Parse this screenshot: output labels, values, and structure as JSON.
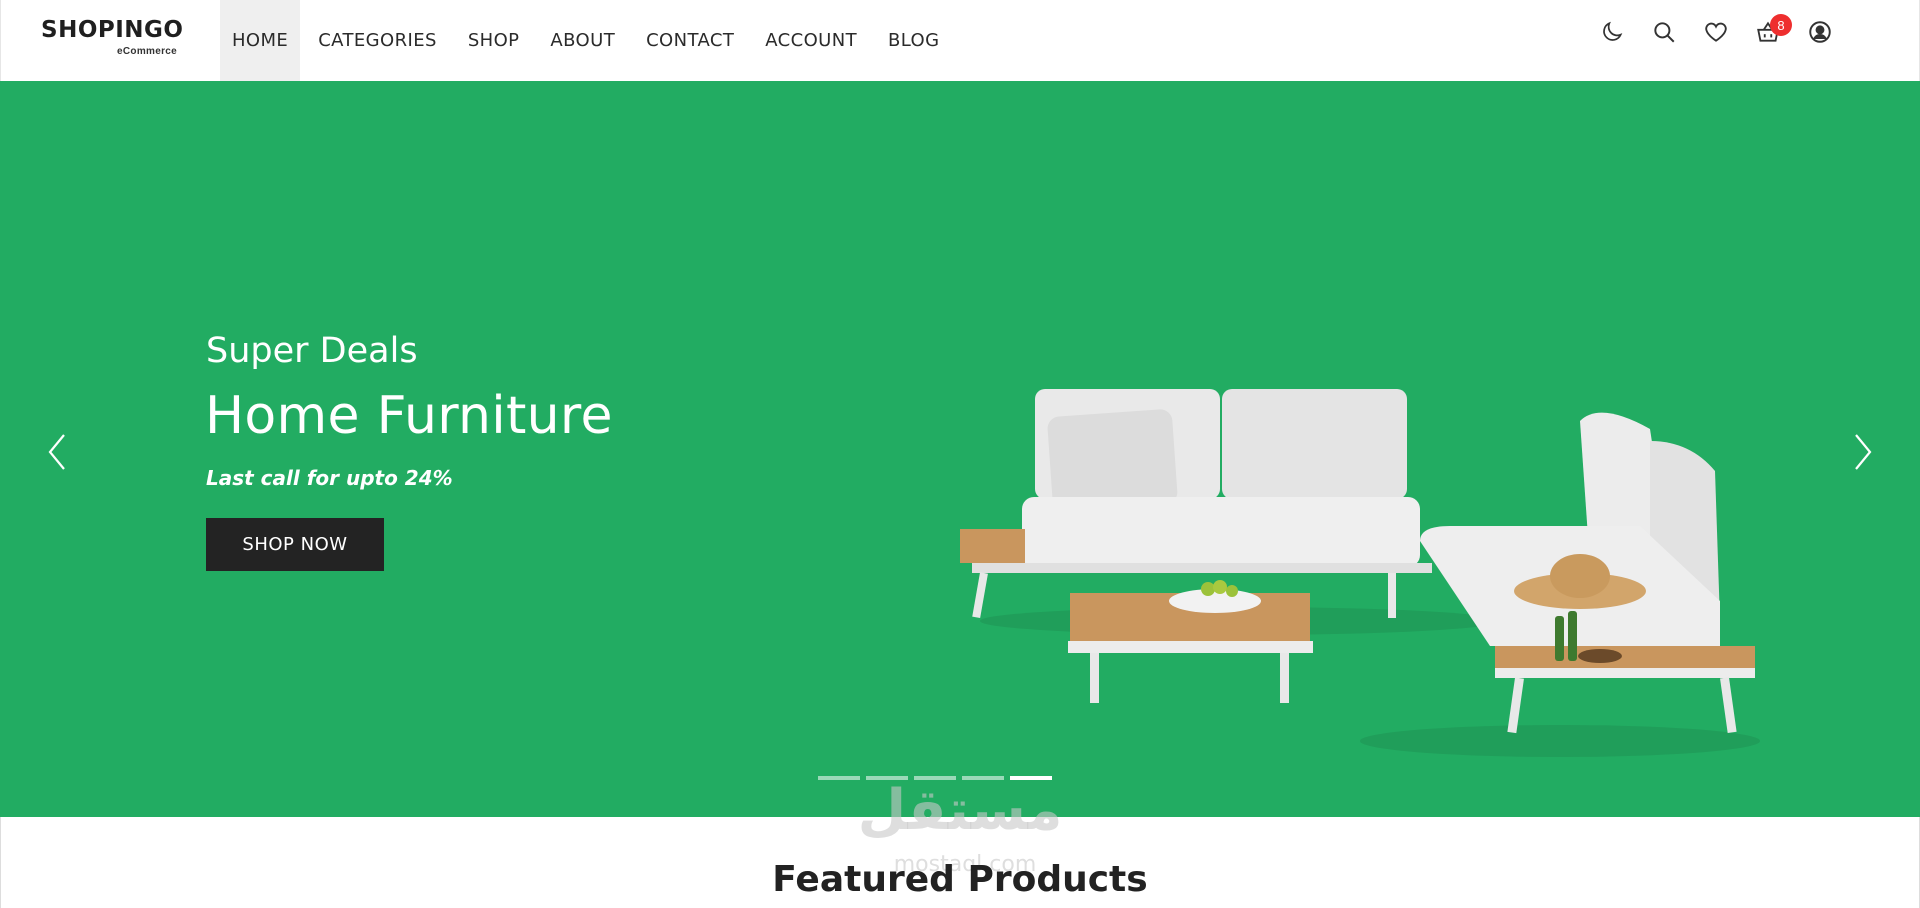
{
  "brand": {
    "name": "SHOPINGO",
    "tagline": "eCommerce"
  },
  "nav": {
    "items": [
      {
        "label": "HOME",
        "active": true
      },
      {
        "label": "CATEGORIES",
        "active": false
      },
      {
        "label": "SHOP",
        "active": false
      },
      {
        "label": "ABOUT",
        "active": false
      },
      {
        "label": "CONTACT",
        "active": false
      },
      {
        "label": "ACCOUNT",
        "active": false
      },
      {
        "label": "BLOG",
        "active": false
      }
    ]
  },
  "header_icons": {
    "theme": "moon-icon",
    "search": "search-icon",
    "wishlist": "heart-icon",
    "cart": "basket-icon",
    "cart_count": "8",
    "account": "user-circle-icon"
  },
  "hero": {
    "kicker": "Super Deals",
    "title": "Home Furniture",
    "tagline": "Last call for upto 24%",
    "cta": "SHOP NOW",
    "slide_count": 5,
    "active_slide": 5
  },
  "watermark": {
    "text": "مستقل",
    "sub": "mostaql.com"
  },
  "featured": {
    "title": "Featured Products"
  },
  "colors": {
    "hero_bg": "#22ac62",
    "button_bg": "#232323",
    "badge_bg": "#ee2e2e",
    "active_nav_bg": "#efefef"
  }
}
